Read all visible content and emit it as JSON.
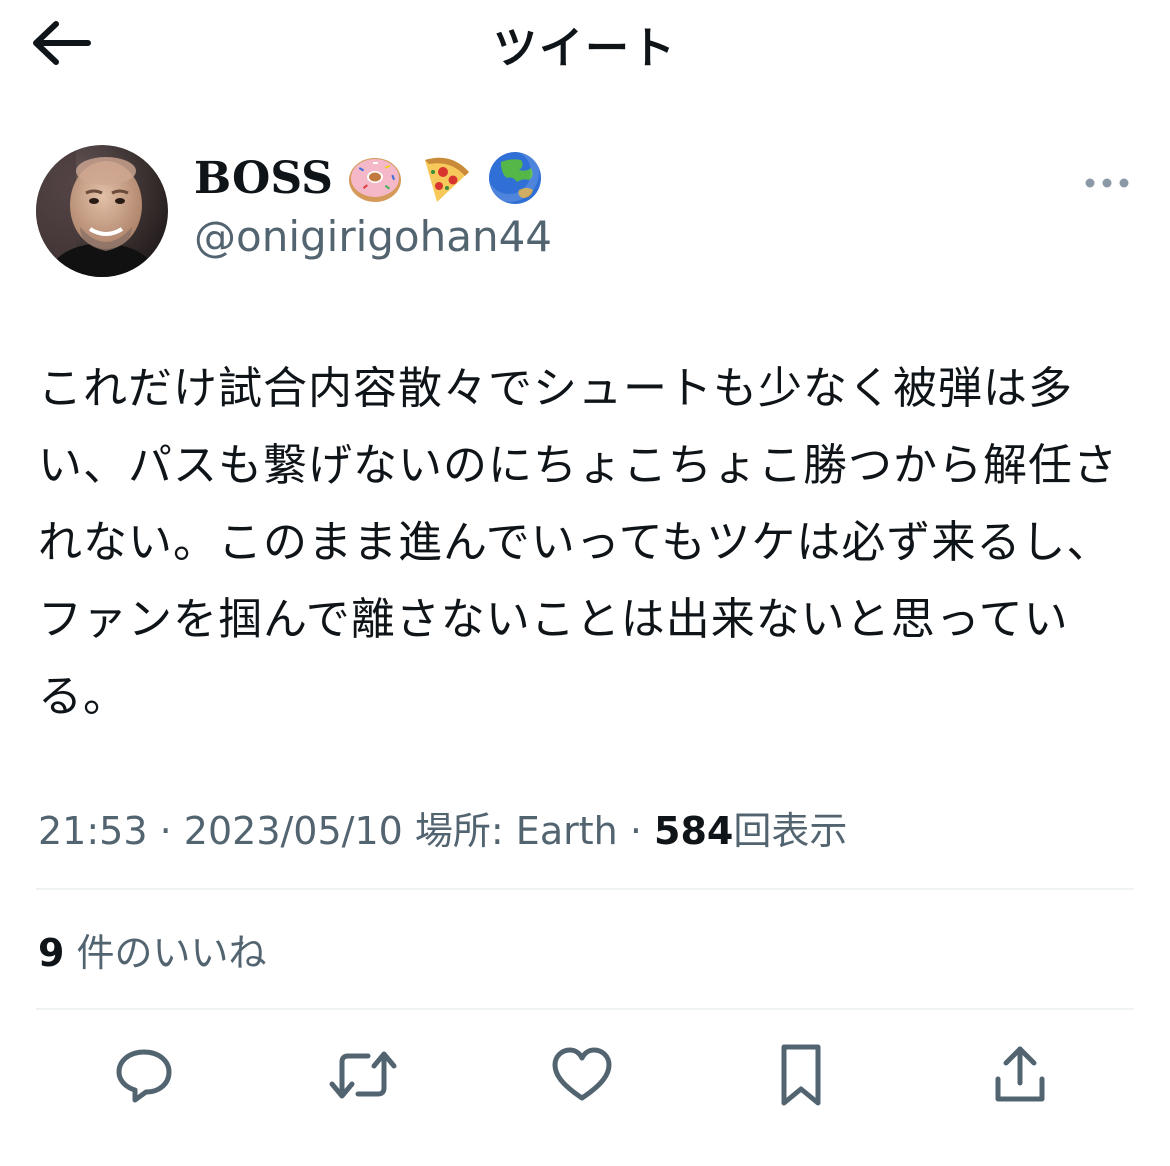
{
  "header": {
    "title": "ツイート",
    "back_icon": "arrow-left-icon"
  },
  "author": {
    "display_name": "BOSS",
    "emojis": [
      "doughnut-emoji",
      "pizza-emoji",
      "globe-asia-australia-emoji"
    ],
    "handle": "@onigirigohan44"
  },
  "tweet": {
    "text": "これだけ試合内容散々でシュートも少なく被弾は多い、パスも繋げないのにちょこちょこ勝つから解任されない。このまま進んでいってもツケは必ず来るし、ファンを掴んで離さないことは出来ないと思っている。"
  },
  "meta": {
    "time": "21:53",
    "date": "2023/05/10",
    "location_label": "場所: Earth",
    "separator": "·",
    "views_count": "584",
    "views_label": "回表示"
  },
  "likes": {
    "count": "9",
    "label": "件のいいね"
  },
  "actions": [
    "reply-icon",
    "retweet-icon",
    "like-icon",
    "bookmark-icon",
    "share-icon"
  ],
  "colors": {
    "text_primary": "#0f1419",
    "text_secondary": "#536471",
    "divider": "#eff3f4"
  }
}
